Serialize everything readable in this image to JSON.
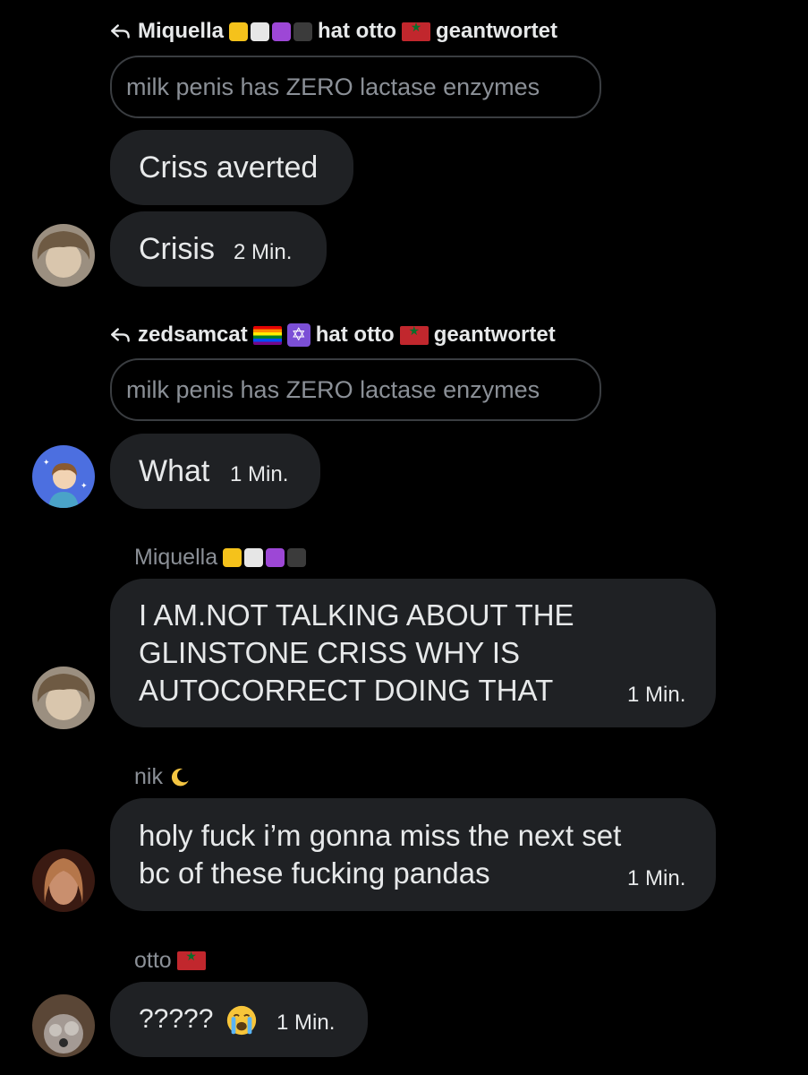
{
  "blocks": [
    {
      "reply": {
        "from": "Miquella",
        "from_emojis": [
          "yellow-square",
          "white-square",
          "purple-square",
          "black-square"
        ],
        "verb": "hat otto",
        "to_flag": "morocco-flag",
        "to": "geantwortet"
      },
      "quote": "milk penis has ZERO lactase enzymes"
    }
  ],
  "messages": {
    "m1": {
      "text": "Criss averted"
    },
    "m2": {
      "text": "Crisis",
      "time": "2 Min."
    },
    "reply2": {
      "from": "zedsamcat",
      "verb": "hat otto",
      "to": "geantwortet",
      "quote": "milk penis has ZERO lactase enzymes"
    },
    "m3": {
      "text": "What",
      "time": "1 Min."
    },
    "m4": {
      "sender": "Miquella",
      "text": "I AM.NOT TALKING ABOUT THE\nGLINSTONE CRISS WHY IS\nAUTOCORRECT DOING THAT",
      "time": "1 Min."
    },
    "m5": {
      "sender": "nik",
      "text": "holy fuck i’m gonna miss the next set\nbc of these fucking pandas",
      "time": "1 Min."
    },
    "m6": {
      "sender": "otto",
      "text": "?????",
      "time": "1 Min."
    }
  },
  "colors": {
    "background": "#000000",
    "bubble": "#1f2124",
    "muted": "#8b9097",
    "text": "#e7e9ea"
  },
  "icons": {
    "reply": "reply-arrow-icon",
    "crying": "loudly-crying-face-icon",
    "moon": "crescent-moon-icon"
  }
}
